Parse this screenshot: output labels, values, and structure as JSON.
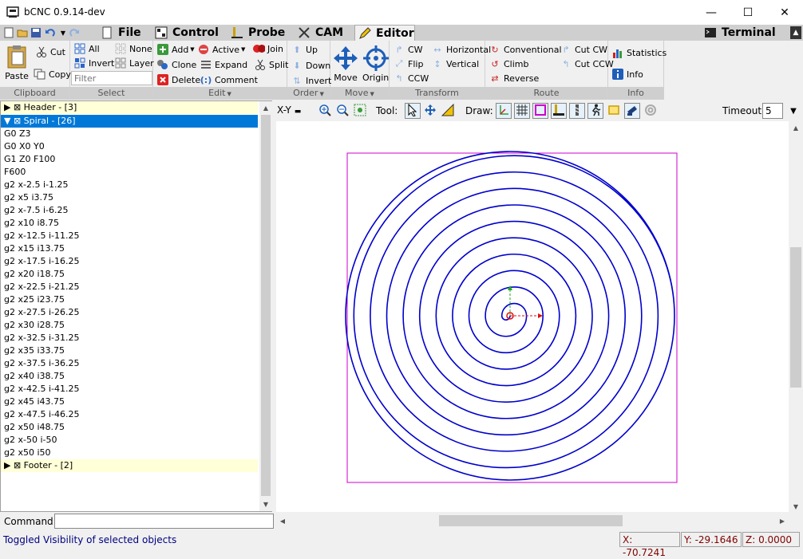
{
  "window": {
    "title": "bCNC 0.9.14-dev",
    "minimize": "—",
    "maximize": "☐",
    "close": "✕"
  },
  "tabs": [
    {
      "label": "File"
    },
    {
      "label": "Control"
    },
    {
      "label": "Probe"
    },
    {
      "label": "CAM"
    },
    {
      "label": "Editor"
    },
    {
      "label": "Terminal"
    }
  ],
  "ribbon_collapse": "▲",
  "ribbon": {
    "clipboard": {
      "label": "Clipboard",
      "paste": "Paste",
      "cut": "Cut",
      "copy": "Copy"
    },
    "select": {
      "label": "Select",
      "all": "All",
      "none": "None",
      "invert": "Invert",
      "layer": "Layer",
      "filter_placeholder": "Filter"
    },
    "edit": {
      "label": "Edit",
      "add": "Add",
      "active": "Active",
      "join": "Join",
      "clone": "Clone",
      "split": "Split",
      "expand": "Expand",
      "delete": "Delete",
      "comment": "Comment"
    },
    "order": {
      "label": "Order",
      "up": "Up",
      "down": "Down",
      "invert": "Invert"
    },
    "move": {
      "label": "Move",
      "move": "Move",
      "origin": "Origin"
    },
    "transform": {
      "label": "Transform",
      "cw": "CW",
      "horizontal": "Horizontal",
      "flip": "Flip",
      "vertical": "Vertical",
      "ccw": "CCW"
    },
    "route": {
      "label": "Route",
      "conventional": "Conventional",
      "cut_cw": "Cut CW",
      "climb": "Climb",
      "cut_ccw": "Cut CCW",
      "reverse": "Reverse"
    },
    "info": {
      "label": "Info",
      "statistics": "Statistics",
      "info": "Info"
    }
  },
  "tree": {
    "header": "▶ ⊠ Header - [3]",
    "spiral": "▼ ⊠ Spiral - [26]",
    "footer": "▶ ⊠ Footer - [2]",
    "gcode": [
      "G0 Z3",
      "G0 X0 Y0",
      "G1 Z0 F100",
      "F600",
      "g2 x-2.5 i-1.25",
      "g2 x5 i3.75",
      "g2 x-7.5 i-6.25",
      "g2 x10 i8.75",
      "g2 x-12.5 i-11.25",
      "g2 x15 i13.75",
      "g2 x-17.5 i-16.25",
      "g2 x20 i18.75",
      "g2 x-22.5 i-21.25",
      "g2 x25 i23.75",
      "g2 x-27.5 i-26.25",
      "g2 x30 i28.75",
      "g2 x-32.5 i-31.25",
      "g2 x35 i33.75",
      "g2 x-37.5 i-36.25",
      "g2 x40 i38.75",
      "g2 x-42.5 i-41.25",
      "g2 x45 i43.75",
      "g2 x-47.5 i-46.25",
      "g2 x50 i48.75",
      "g2 x-50 i-50",
      "g2 x50 i50"
    ]
  },
  "canvas_toolbar": {
    "view": "X-Y",
    "tool_label": "Tool:",
    "draw_label": "Draw:",
    "timeout_label": "Timeout:",
    "timeout_value": "5"
  },
  "command": {
    "label": "Command:"
  },
  "status": {
    "message": "Toggled Visibility of selected objects",
    "x": "X: -70.7241",
    "y": "Y: -29.1646",
    "z": "Z: 0.0000"
  },
  "colors": {
    "path": "#0000cc",
    "margins": "#cc00cc",
    "selection": "#0078d7",
    "block_bg": "#ffffd8"
  }
}
